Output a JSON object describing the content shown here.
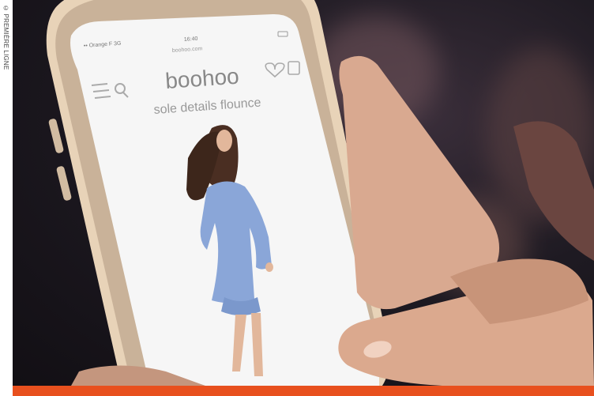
{
  "credit": "© PREMIÈRE LIGNE",
  "phone": {
    "status": {
      "carrier": "•• Orange F 3G",
      "time": "16:40",
      "url": "boohoo.com"
    },
    "brand": "boohoo",
    "product_title": "sole details flounce"
  },
  "colors": {
    "accent_bar": "#e8501e",
    "dress": "#8aa6d8",
    "phone_frame": "#e8d3b8"
  },
  "icons": [
    "menu-icon",
    "search-icon",
    "heart-icon",
    "bag-icon"
  ]
}
